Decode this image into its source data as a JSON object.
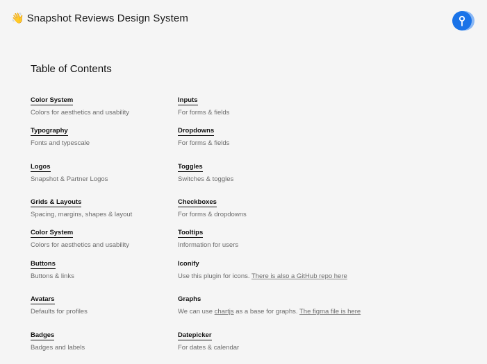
{
  "header": {
    "emoji": "👋",
    "title": "Snapshot Reviews Design System"
  },
  "toc": {
    "title": "Table of Contents",
    "left": [
      {
        "title": "Color System",
        "desc": "Colors for aesthetics and usability"
      },
      {
        "title": "Typography",
        "desc": "Fonts and typescale"
      },
      {
        "title": "Logos",
        "desc": "Snapshot & Partner Logos"
      },
      {
        "title": "Grids & Layouts",
        "desc": "Spacing, margins, shapes & layout"
      },
      {
        "title": "Color System",
        "desc": "Colors for aesthetics and usability"
      },
      {
        "title": "Buttons",
        "desc": "Buttons & links"
      },
      {
        "title": "Avatars",
        "desc": "Defaults for profiles"
      },
      {
        "title": "Badges",
        "desc": "Badges and labels"
      }
    ],
    "right": [
      {
        "title": "Inputs",
        "desc": "For forms & fields"
      },
      {
        "title": "Dropdowns",
        "desc": "For forms & fields"
      },
      {
        "title": "Toggles",
        "desc": "Switches & toggles"
      },
      {
        "title": "Checkboxes",
        "desc": "For forms & dropdowns"
      },
      {
        "title": "Tooltips",
        "desc": "Information for users"
      },
      {
        "title": "Iconify",
        "desc_pre": "Use this plugin for icons. ",
        "desc_link": "There is also a GitHub repo here"
      },
      {
        "title": "Graphs",
        "desc_pre": "We can use ",
        "desc_link1": "chartjs",
        "desc_mid": " as a base for graphs. ",
        "desc_link2": "The figma file is here"
      },
      {
        "title": "Datepicker",
        "desc": "For dates & calendar"
      }
    ]
  },
  "colors": {
    "logo_primary": "#1a73e8",
    "logo_secondary": "#8ab8f5"
  }
}
